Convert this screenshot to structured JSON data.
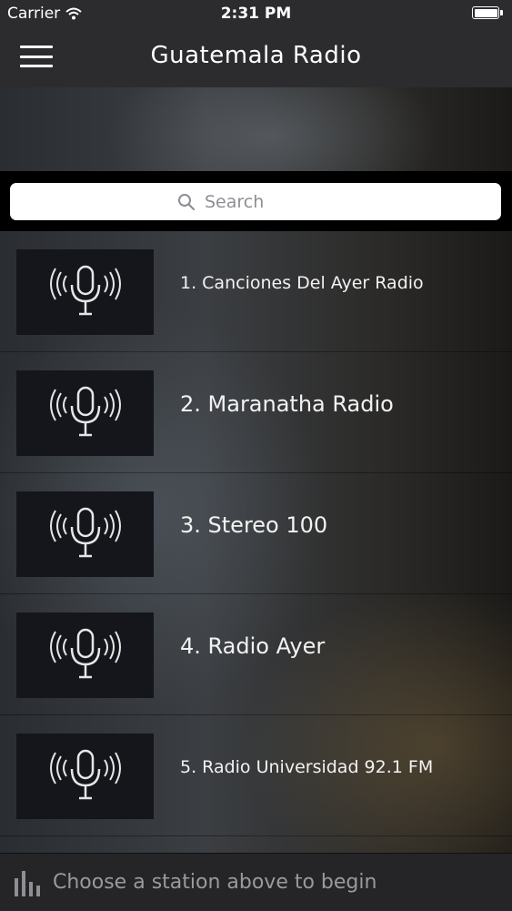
{
  "status": {
    "carrier": "Carrier",
    "time": "2:31 PM"
  },
  "nav": {
    "title": "Guatemala Radio",
    "menu_icon": "hamburger-menu-icon"
  },
  "search": {
    "placeholder": "Search",
    "value": ""
  },
  "stations": [
    {
      "label": "1. Canciones Del Ayer Radio",
      "icon": "microphone-broadcast-icon"
    },
    {
      "label": "2. Maranatha Radio",
      "icon": "microphone-broadcast-icon"
    },
    {
      "label": "3. Stereo 100",
      "icon": "microphone-broadcast-icon"
    },
    {
      "label": "4. Radio Ayer",
      "icon": "microphone-broadcast-icon"
    },
    {
      "label": "5. Radio Universidad 92.1 FM",
      "icon": "microphone-broadcast-icon"
    }
  ],
  "player": {
    "message": "Choose a station above to begin",
    "icon": "equalizer-bars-icon"
  },
  "colors": {
    "bar_bg": "#2c2c2e",
    "search_band": "#000000",
    "thumb_bg": "#14161b"
  }
}
